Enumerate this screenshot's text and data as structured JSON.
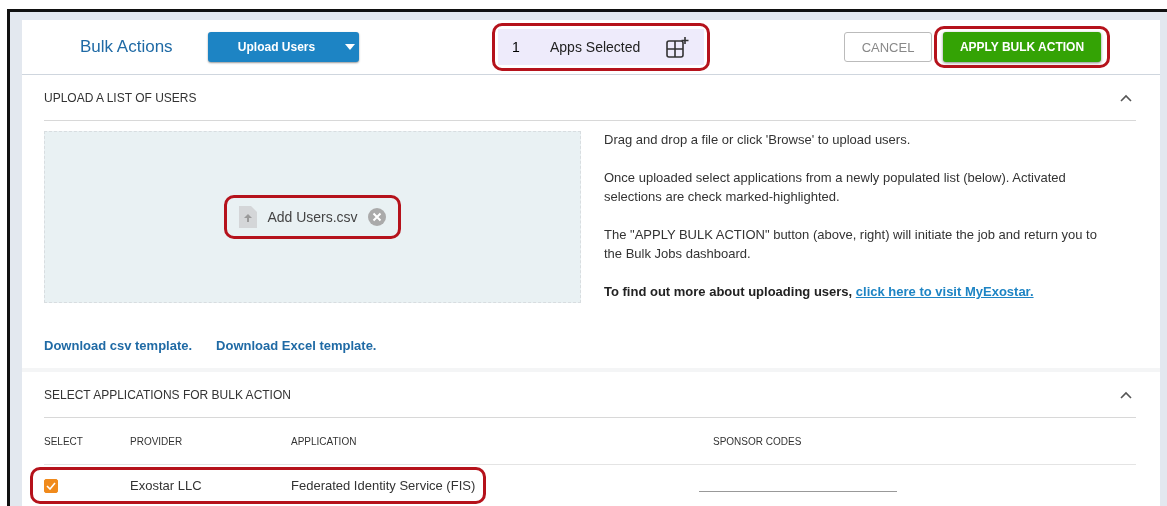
{
  "header": {
    "title": "Bulk Actions",
    "upload_button": {
      "label": "Upload Users"
    },
    "apps_selected": {
      "count": "1",
      "label": "Apps Selected",
      "highlighted": true
    },
    "cancel": {
      "label": "CANCEL"
    },
    "apply": {
      "label": "APPLY BULK ACTION",
      "highlighted": true
    }
  },
  "upload_section": {
    "title": "UPLOAD A LIST OF USERS",
    "expanded": true,
    "file": {
      "name": "Add Users.csv",
      "highlighted": true
    },
    "instructions": [
      "Drag and drop a file or click 'Browse' to upload users.",
      "Once uploaded select applications from a newly populated list (below). Activated selections are check marked-highlighted.",
      "The \"APPLY BULK ACTION\" button (above, right) will initiate the job and return you to the Bulk Jobs dashboard."
    ],
    "more_info": {
      "text": "To find out more about uploading users,",
      "link": "click here to visit MyExostar."
    },
    "downloads": [
      "Download csv template.",
      "Download Excel template."
    ]
  },
  "apps_section": {
    "title": "SELECT APPLICATIONS FOR BULK ACTION",
    "expanded": true,
    "columns": [
      "SELECT",
      "PROVIDER",
      "APPLICATION",
      "SPONSOR CODES"
    ],
    "rows": [
      {
        "checked": true,
        "provider": "Exostar LLC",
        "application": "Federated Identity Service (FIS)",
        "highlighted": true
      }
    ]
  }
}
